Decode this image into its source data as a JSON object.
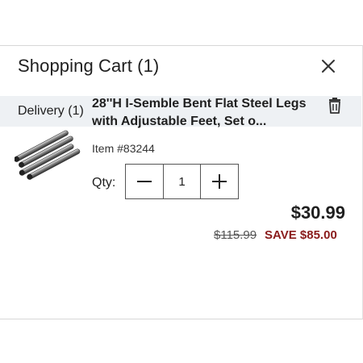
{
  "cart": {
    "title": "Shopping Cart (1)",
    "close_icon": "close-icon"
  },
  "section": {
    "label": "Delivery (1)"
  },
  "item": {
    "name": "28''H I-Semble Bent Flat Steel Legs with Adjustable Feet, Set o...",
    "item_number": "Item #83244",
    "qty_label": "Qty:",
    "quantity": "1",
    "price": "$30.99",
    "original_price": "$115.99",
    "savings": "SAVE $85.00",
    "image_icon": "steel-legs-product-image",
    "trash_icon": "trash-icon"
  },
  "colors": {
    "section_bg": "#eef1f4",
    "savings": "#8a1c1c",
    "text": "#1f1f1f"
  }
}
